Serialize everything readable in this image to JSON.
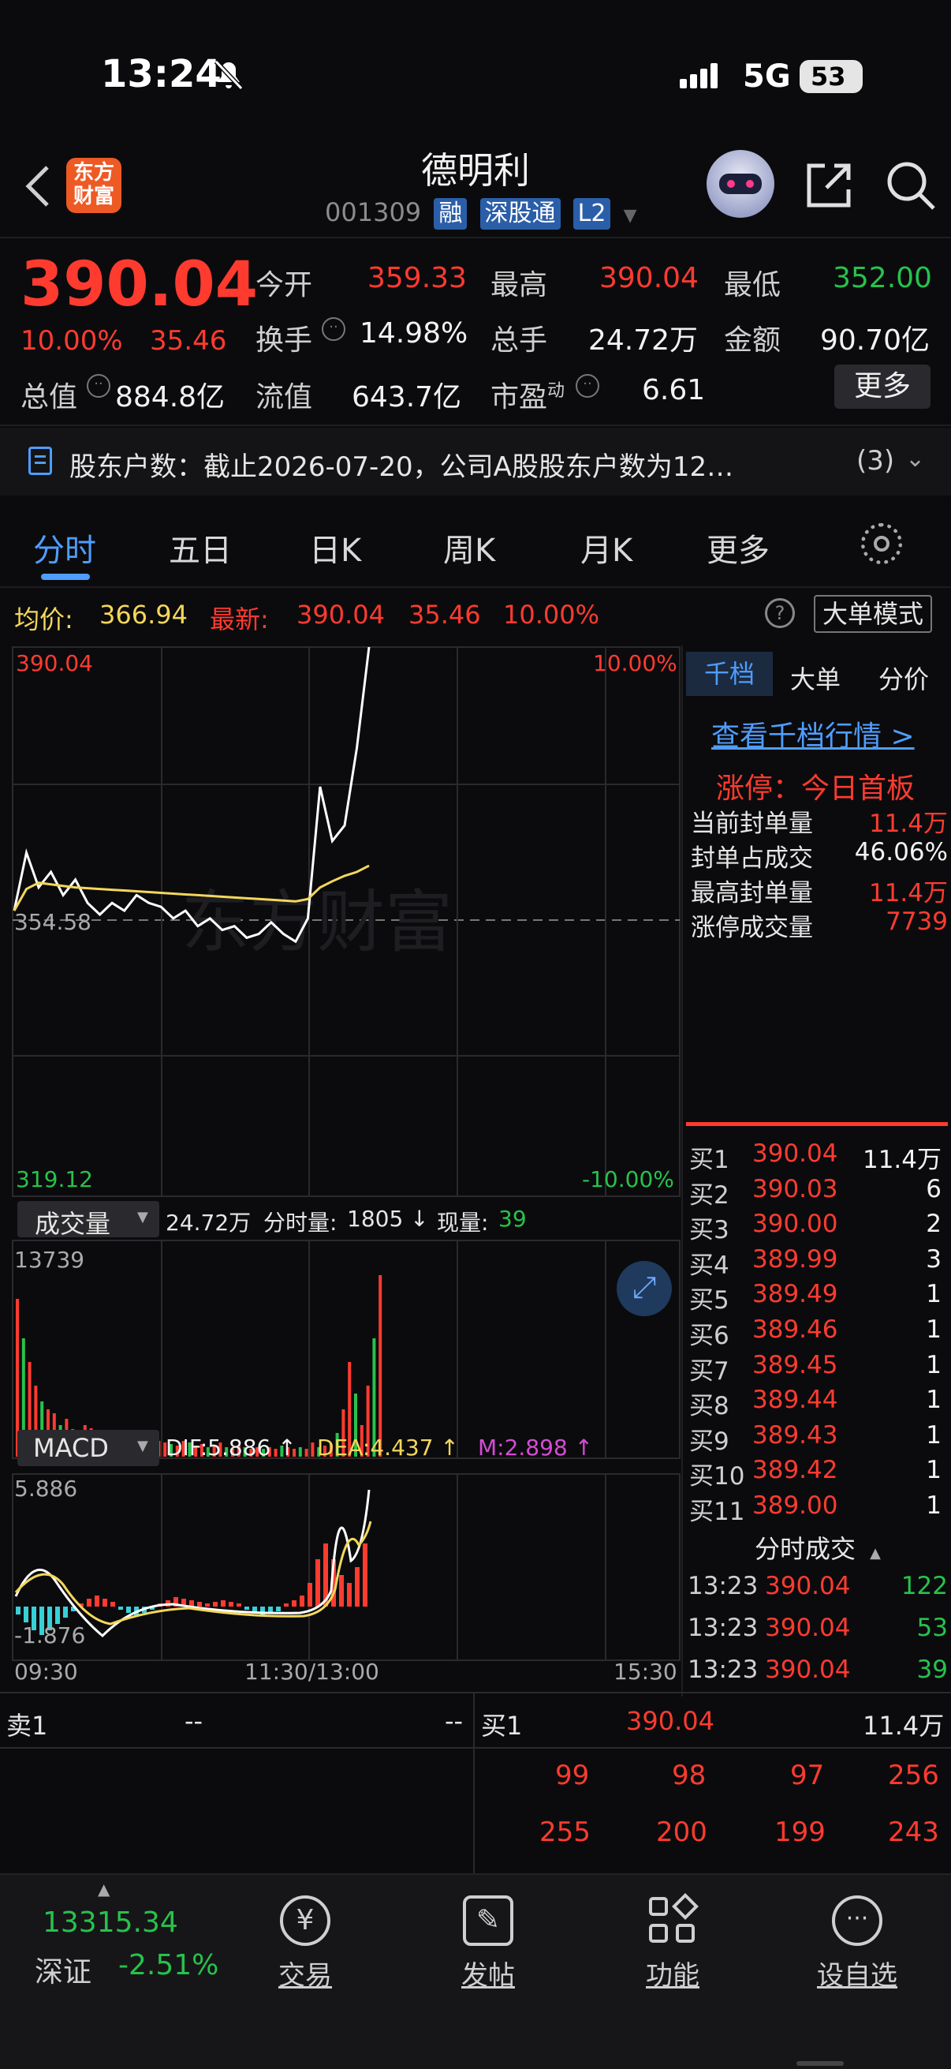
{
  "status_bar": {
    "time": "13:24",
    "network": "5G",
    "battery": "53"
  },
  "header": {
    "logo_text": "东方财富",
    "title": "德明利",
    "code": "001309",
    "badges": [
      "融",
      "深股通",
      "L2"
    ]
  },
  "quote": {
    "price": "390.04",
    "change_pct": "10.00%",
    "change": "35.46",
    "open_label": "今开",
    "open": "359.33",
    "high_label": "最高",
    "high": "390.04",
    "low_label": "最低",
    "low": "352.00",
    "turnover_label": "换手",
    "turnover": "14.98%",
    "volume_label": "总手",
    "volume": "24.72万",
    "amount_label": "金额",
    "amount": "90.70亿",
    "mktcap_label": "总值",
    "mktcap": "884.8亿",
    "float_label": "流值",
    "float": "643.7亿",
    "pe_label": "市盈",
    "pe_sup": "动",
    "pe": "6.61",
    "more_label": "更多"
  },
  "notice": {
    "text": "股东户数：截止2026-07-20，公司A股股东户数为12…",
    "count": "(3)"
  },
  "tabs": [
    "分时",
    "五日",
    "日K",
    "周K",
    "月K",
    "更多"
  ],
  "chart_header": {
    "avg_label": "均价:",
    "avg": "366.94",
    "latest_label": "最新:",
    "latest": "390.04",
    "latest_chg": "35.46",
    "latest_pct": "10.00%",
    "mode_button": "大单模式"
  },
  "chart_labels": {
    "top_price": "390.04",
    "mid_price": "354.58",
    "bottom_price": "319.12",
    "top_pct": "10.00%",
    "bottom_pct": "-10.00%",
    "watermark": "东方财富",
    "vol_tab": "成交量",
    "vol_total": "24.72万",
    "vol_min_label": "分时量:",
    "vol_min": "1805 ↓",
    "vol_now_label": "现量:",
    "vol_now": "39",
    "vol_max": "13739",
    "macd_tab": "MACD",
    "dif": "DIF:5.886 ↑",
    "dea": "DEA:4.437 ↑",
    "m": "M:2.898 ↑",
    "macd_top": "5.886",
    "macd_bottom": "-1.876",
    "t_start": "09:30",
    "t_mid": "11:30/13:00",
    "t_end": "15:30"
  },
  "chart_data": {
    "type": "line",
    "series": [
      {
        "name": "price",
        "values": [
          356.0,
          363.5,
          359.0,
          361.0,
          358.0,
          360.0,
          357.0,
          355.5,
          357.0,
          356.0,
          358.0,
          357.0,
          356.5,
          355.0,
          356.0,
          354.0,
          355.0,
          353.5,
          354.0,
          352.5,
          353.0,
          354.5,
          353.0,
          352.0,
          355.0,
          372.0,
          365.0,
          367.0,
          377.0,
          390.04
        ]
      },
      {
        "name": "avg",
        "values": [
          356.0,
          358.8,
          359.6,
          359.4,
          359.2,
          359.0,
          358.9,
          358.8,
          358.7,
          358.6,
          358.5,
          358.4,
          358.3,
          358.2,
          358.1,
          358.0,
          357.9,
          357.8,
          357.7,
          357.6,
          357.5,
          357.4,
          357.3,
          357.2,
          357.5,
          359.0,
          359.8,
          360.5,
          361.0,
          361.8
        ]
      }
    ],
    "ylim": [
      319.12,
      390.04
    ]
  },
  "right_panel": {
    "tabs": [
      "千档",
      "大单",
      "分价"
    ],
    "link": "查看千档行情 >",
    "limit_title": "涨停：今日首板",
    "rows": [
      {
        "label": "当前封单量",
        "value": "11.4万"
      },
      {
        "label": "封单占成交",
        "value": "46.06%"
      },
      {
        "label": "最高封单量",
        "value": "11.4万"
      },
      {
        "label": "涨停成交量",
        "value": "7739"
      }
    ],
    "bids": [
      {
        "label": "买1",
        "price": "390.04",
        "vol": "11.4万"
      },
      {
        "label": "买2",
        "price": "390.03",
        "vol": "6"
      },
      {
        "label": "买3",
        "price": "390.00",
        "vol": "2"
      },
      {
        "label": "买4",
        "price": "389.99",
        "vol": "3"
      },
      {
        "label": "买5",
        "price": "389.49",
        "vol": "1"
      },
      {
        "label": "买6",
        "price": "389.46",
        "vol": "1"
      },
      {
        "label": "买7",
        "price": "389.45",
        "vol": "1"
      },
      {
        "label": "买8",
        "price": "389.44",
        "vol": "1"
      },
      {
        "label": "买9",
        "price": "389.43",
        "vol": "1"
      },
      {
        "label": "买10",
        "price": "389.42",
        "vol": "1"
      },
      {
        "label": "买11",
        "price": "389.00",
        "vol": "1"
      }
    ],
    "ticks_title": "分时成交",
    "ticks": [
      {
        "time": "13:23",
        "price": "390.04",
        "vol": "122"
      },
      {
        "time": "13:23",
        "price": "390.04",
        "vol": "53"
      },
      {
        "time": "13:23",
        "price": "390.04",
        "vol": "39"
      }
    ]
  },
  "order_book": {
    "sell_label": "卖1",
    "sell_price": "--",
    "sell_vol": "--",
    "buy_label": "买1",
    "buy_price": "390.04",
    "buy_vol": "11.4万",
    "queue_row1": [
      "99",
      "98",
      "97",
      "256"
    ],
    "queue_row2": [
      "255",
      "200",
      "199",
      "243"
    ]
  },
  "bottom_nav": {
    "index_value": "13315.34",
    "index_name": "深证",
    "index_pct": "-2.51%",
    "items": [
      "交易",
      "发帖",
      "功能",
      "设自选"
    ]
  }
}
